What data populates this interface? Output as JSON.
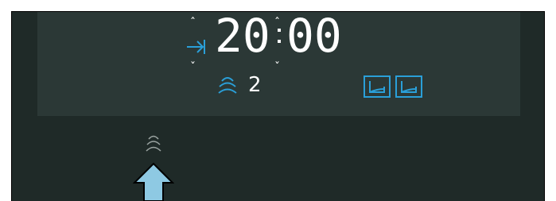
{
  "display": {
    "time": "20:00",
    "hours": "20",
    "minutes": "00",
    "steam_level": "2"
  },
  "icons": {
    "duration": "arrow-to-bar-icon",
    "steam": "steam-icon",
    "water_tank": "water-tank-icon",
    "drip_tray": "drip-tray-icon",
    "hint_steam": "steam-icon",
    "hint_arrow": "up-arrow-icon"
  },
  "colors": {
    "accent": "#2a9fd8",
    "display_bg": "#2b3836",
    "frame_bg": "#1f2a28",
    "digits": "#ffffff",
    "arrow": "#8ec9e3"
  }
}
